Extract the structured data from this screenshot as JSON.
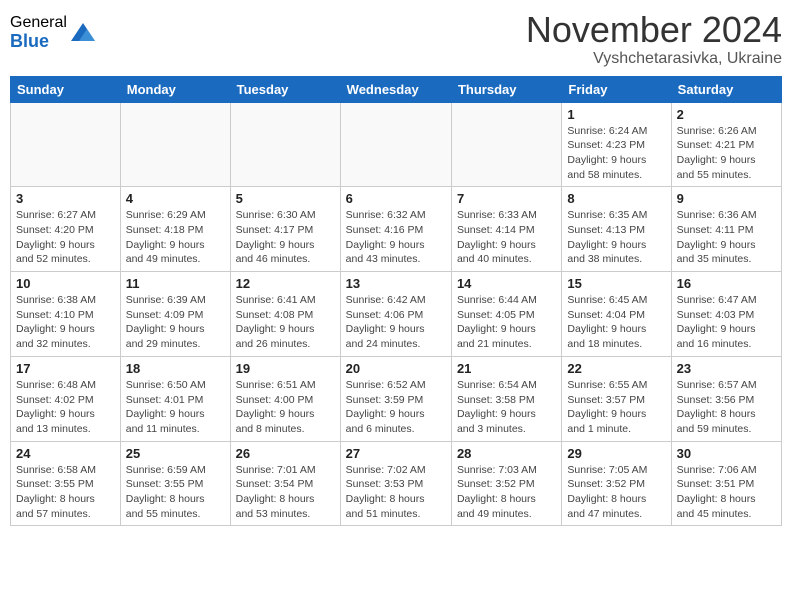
{
  "logo": {
    "general": "General",
    "blue": "Blue"
  },
  "title": "November 2024",
  "location": "Vyshchetarasivka, Ukraine",
  "weekdays": [
    "Sunday",
    "Monday",
    "Tuesday",
    "Wednesday",
    "Thursday",
    "Friday",
    "Saturday"
  ],
  "weeks": [
    [
      {
        "day": "",
        "info": ""
      },
      {
        "day": "",
        "info": ""
      },
      {
        "day": "",
        "info": ""
      },
      {
        "day": "",
        "info": ""
      },
      {
        "day": "",
        "info": ""
      },
      {
        "day": "1",
        "info": "Sunrise: 6:24 AM\nSunset: 4:23 PM\nDaylight: 9 hours\nand 58 minutes."
      },
      {
        "day": "2",
        "info": "Sunrise: 6:26 AM\nSunset: 4:21 PM\nDaylight: 9 hours\nand 55 minutes."
      }
    ],
    [
      {
        "day": "3",
        "info": "Sunrise: 6:27 AM\nSunset: 4:20 PM\nDaylight: 9 hours\nand 52 minutes."
      },
      {
        "day": "4",
        "info": "Sunrise: 6:29 AM\nSunset: 4:18 PM\nDaylight: 9 hours\nand 49 minutes."
      },
      {
        "day": "5",
        "info": "Sunrise: 6:30 AM\nSunset: 4:17 PM\nDaylight: 9 hours\nand 46 minutes."
      },
      {
        "day": "6",
        "info": "Sunrise: 6:32 AM\nSunset: 4:16 PM\nDaylight: 9 hours\nand 43 minutes."
      },
      {
        "day": "7",
        "info": "Sunrise: 6:33 AM\nSunset: 4:14 PM\nDaylight: 9 hours\nand 40 minutes."
      },
      {
        "day": "8",
        "info": "Sunrise: 6:35 AM\nSunset: 4:13 PM\nDaylight: 9 hours\nand 38 minutes."
      },
      {
        "day": "9",
        "info": "Sunrise: 6:36 AM\nSunset: 4:11 PM\nDaylight: 9 hours\nand 35 minutes."
      }
    ],
    [
      {
        "day": "10",
        "info": "Sunrise: 6:38 AM\nSunset: 4:10 PM\nDaylight: 9 hours\nand 32 minutes."
      },
      {
        "day": "11",
        "info": "Sunrise: 6:39 AM\nSunset: 4:09 PM\nDaylight: 9 hours\nand 29 minutes."
      },
      {
        "day": "12",
        "info": "Sunrise: 6:41 AM\nSunset: 4:08 PM\nDaylight: 9 hours\nand 26 minutes."
      },
      {
        "day": "13",
        "info": "Sunrise: 6:42 AM\nSunset: 4:06 PM\nDaylight: 9 hours\nand 24 minutes."
      },
      {
        "day": "14",
        "info": "Sunrise: 6:44 AM\nSunset: 4:05 PM\nDaylight: 9 hours\nand 21 minutes."
      },
      {
        "day": "15",
        "info": "Sunrise: 6:45 AM\nSunset: 4:04 PM\nDaylight: 9 hours\nand 18 minutes."
      },
      {
        "day": "16",
        "info": "Sunrise: 6:47 AM\nSunset: 4:03 PM\nDaylight: 9 hours\nand 16 minutes."
      }
    ],
    [
      {
        "day": "17",
        "info": "Sunrise: 6:48 AM\nSunset: 4:02 PM\nDaylight: 9 hours\nand 13 minutes."
      },
      {
        "day": "18",
        "info": "Sunrise: 6:50 AM\nSunset: 4:01 PM\nDaylight: 9 hours\nand 11 minutes."
      },
      {
        "day": "19",
        "info": "Sunrise: 6:51 AM\nSunset: 4:00 PM\nDaylight: 9 hours\nand 8 minutes."
      },
      {
        "day": "20",
        "info": "Sunrise: 6:52 AM\nSunset: 3:59 PM\nDaylight: 9 hours\nand 6 minutes."
      },
      {
        "day": "21",
        "info": "Sunrise: 6:54 AM\nSunset: 3:58 PM\nDaylight: 9 hours\nand 3 minutes."
      },
      {
        "day": "22",
        "info": "Sunrise: 6:55 AM\nSunset: 3:57 PM\nDaylight: 9 hours\nand 1 minute."
      },
      {
        "day": "23",
        "info": "Sunrise: 6:57 AM\nSunset: 3:56 PM\nDaylight: 8 hours\nand 59 minutes."
      }
    ],
    [
      {
        "day": "24",
        "info": "Sunrise: 6:58 AM\nSunset: 3:55 PM\nDaylight: 8 hours\nand 57 minutes."
      },
      {
        "day": "25",
        "info": "Sunrise: 6:59 AM\nSunset: 3:55 PM\nDaylight: 8 hours\nand 55 minutes."
      },
      {
        "day": "26",
        "info": "Sunrise: 7:01 AM\nSunset: 3:54 PM\nDaylight: 8 hours\nand 53 minutes."
      },
      {
        "day": "27",
        "info": "Sunrise: 7:02 AM\nSunset: 3:53 PM\nDaylight: 8 hours\nand 51 minutes."
      },
      {
        "day": "28",
        "info": "Sunrise: 7:03 AM\nSunset: 3:52 PM\nDaylight: 8 hours\nand 49 minutes."
      },
      {
        "day": "29",
        "info": "Sunrise: 7:05 AM\nSunset: 3:52 PM\nDaylight: 8 hours\nand 47 minutes."
      },
      {
        "day": "30",
        "info": "Sunrise: 7:06 AM\nSunset: 3:51 PM\nDaylight: 8 hours\nand 45 minutes."
      }
    ]
  ]
}
